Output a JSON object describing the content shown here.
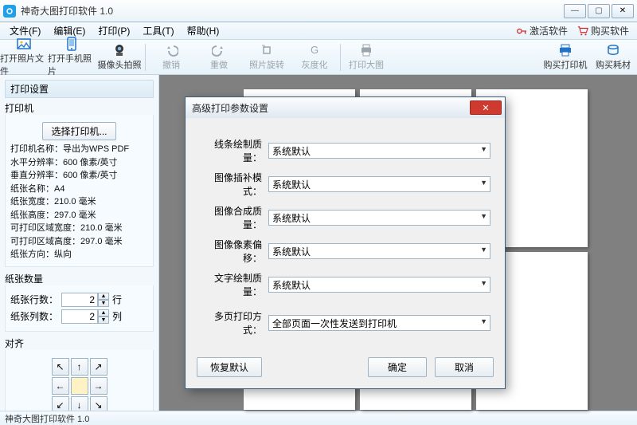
{
  "window": {
    "title": "神奇大图打印软件 1.0"
  },
  "menu": {
    "file": "文件(F)",
    "edit": "编辑(E)",
    "print": "打印(P)",
    "tools": "工具(T)",
    "help": "帮助(H)",
    "activate": "激活软件",
    "buy": "购买软件"
  },
  "toolbar": {
    "open_image": "打开照片文件",
    "open_phone": "打开手机照片",
    "camera": "摄像头拍照",
    "undo": "撤销",
    "redo": "重做",
    "rotate": "照片旋转",
    "gray": "灰度化",
    "print_big": "打印大图",
    "buy_printer": "购买打印机",
    "buy_supplies": "购买耗材"
  },
  "sidebar": {
    "settings_title": "打印设置",
    "printer_group": "打印机",
    "select_printer_btn": "选择打印机...",
    "info": {
      "l1": "打印机名称：导出为WPS PDF",
      "l2": "水平分辨率：600 像素/英寸",
      "l3": "垂直分辨率：600 像素/英寸",
      "l4": "纸张名称：A4",
      "l5": "纸张宽度：210.0 毫米",
      "l6": "纸张高度：297.0 毫米",
      "l7": "可打印区域宽度：210.0 毫米",
      "l8": "可打印区域高度：297.0 毫米",
      "l9": "纸张方向：纵向"
    },
    "pages_group": "纸张数量",
    "rows_label": "纸张行数：",
    "rows_value": "2",
    "rows_unit": "行",
    "cols_label": "纸张列数：",
    "cols_value": "2",
    "cols_unit": "列",
    "align_group": "对齐"
  },
  "dialog": {
    "title": "高级打印参数设置",
    "fields": {
      "line_quality": {
        "label": "线条绘制质量：",
        "value": "系统默认"
      },
      "interp_mode": {
        "label": "图像插补模式：",
        "value": "系统默认"
      },
      "composite": {
        "label": "图像合成质量：",
        "value": "系统默认"
      },
      "pixel_offset": {
        "label": "图像像素偏移：",
        "value": "系统默认"
      },
      "text_quality": {
        "label": "文字绘制质量：",
        "value": "系统默认"
      },
      "multipage": {
        "label": "多页打印方式：",
        "value": "全部页面一次性发送到打印机"
      }
    },
    "restore": "恢复默认",
    "ok": "确定",
    "cancel": "取消"
  },
  "status": {
    "text": "神奇大图打印软件 1.0"
  }
}
